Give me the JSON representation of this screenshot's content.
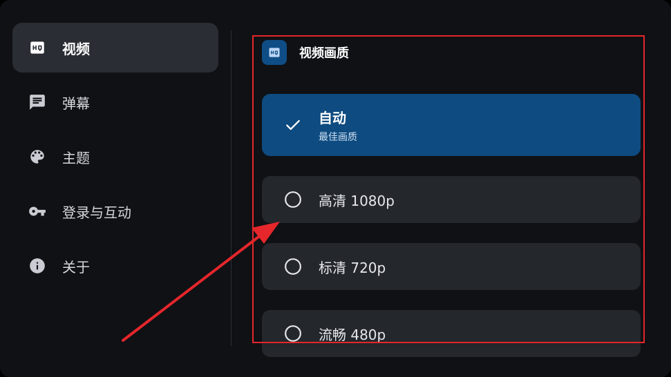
{
  "sidebar": {
    "items": [
      {
        "label": "视频",
        "icon": "hq-icon",
        "active": true
      },
      {
        "label": "弹幕",
        "icon": "chat-icon",
        "active": false
      },
      {
        "label": "主题",
        "icon": "palette-icon",
        "active": false
      },
      {
        "label": "登录与互动",
        "icon": "key-icon",
        "active": false
      },
      {
        "label": "关于",
        "icon": "info-icon",
        "active": false
      }
    ]
  },
  "main": {
    "section_title": "视频画质",
    "options": [
      {
        "label": "自动",
        "sublabel": "最佳画质",
        "selected": true
      },
      {
        "label": "高清 1080p",
        "selected": false
      },
      {
        "label": "标清 720p",
        "selected": false
      },
      {
        "label": "流畅 480p",
        "selected": false
      }
    ]
  },
  "colors": {
    "background": "#0f1115",
    "sidebar_active": "#2a2d33",
    "option_bg": "#24272c",
    "selected_bg": "#0e4b80",
    "annotation_red": "#e5262b"
  }
}
